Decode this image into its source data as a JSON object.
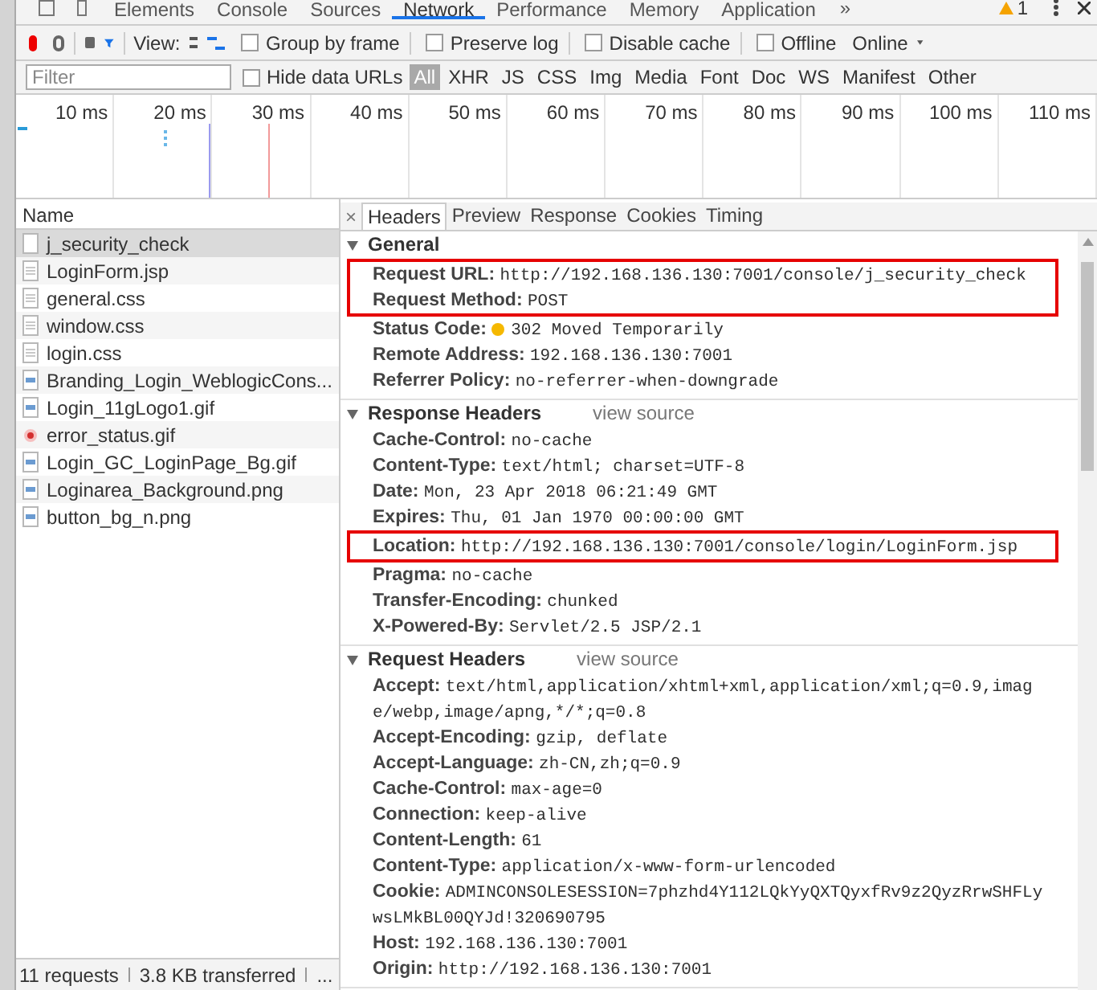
{
  "panel_tabs": [
    {
      "label": "Elements",
      "selected": false
    },
    {
      "label": "Console",
      "selected": false
    },
    {
      "label": "Sources",
      "selected": false
    },
    {
      "label": "Network",
      "selected": true
    },
    {
      "label": "Performance",
      "selected": false
    },
    {
      "label": "Memory",
      "selected": false
    },
    {
      "label": "Application",
      "selected": false
    }
  ],
  "more_tabs": "»",
  "warning_count": "1",
  "toolbar": {
    "recording": true,
    "view_label": "View:",
    "options": [
      {
        "label": "Group by frame",
        "checked": false
      },
      {
        "label": "Preserve log",
        "checked": false
      },
      {
        "label": "Disable cache",
        "checked": false
      },
      {
        "label": "Offline",
        "checked": false
      }
    ],
    "throttling": "Online"
  },
  "filter": {
    "placeholder": "Filter",
    "hide_data_urls": {
      "label": "Hide data URLs",
      "checked": false
    },
    "types": [
      {
        "label": "All",
        "selected": true
      },
      {
        "label": "XHR",
        "selected": false
      },
      {
        "label": "JS",
        "selected": false
      },
      {
        "label": "CSS",
        "selected": false
      },
      {
        "label": "Img",
        "selected": false
      },
      {
        "label": "Media",
        "selected": false
      },
      {
        "label": "Font",
        "selected": false
      },
      {
        "label": "Doc",
        "selected": false
      },
      {
        "label": "WS",
        "selected": false
      },
      {
        "label": "Manifest",
        "selected": false
      },
      {
        "label": "Other",
        "selected": false
      }
    ]
  },
  "timeline": {
    "ticks": [
      "10 ms",
      "20 ms",
      "30 ms",
      "40 ms",
      "50 ms",
      "60 ms",
      "70 ms",
      "80 ms",
      "90 ms",
      "100 ms",
      "110 ms"
    ]
  },
  "requests": {
    "column": "Name",
    "rows": [
      {
        "name": "j_security_check",
        "kind": "blank",
        "selected": true
      },
      {
        "name": "LoginForm.jsp",
        "kind": "document",
        "selected": false
      },
      {
        "name": "general.css",
        "kind": "document",
        "selected": false
      },
      {
        "name": "window.css",
        "kind": "document",
        "selected": false
      },
      {
        "name": "login.css",
        "kind": "document",
        "selected": false
      },
      {
        "name": "Branding_Login_WeblogicCons...",
        "kind": "image",
        "selected": false
      },
      {
        "name": "Login_11gLogo1.gif",
        "kind": "image",
        "selected": false
      },
      {
        "name": "error_status.gif",
        "kind": "error",
        "selected": false
      },
      {
        "name": "Login_GC_LoginPage_Bg.gif",
        "kind": "image",
        "selected": false
      },
      {
        "name": "Loginarea_Background.png",
        "kind": "image",
        "selected": false
      },
      {
        "name": "button_bg_n.png",
        "kind": "image",
        "selected": false
      }
    ]
  },
  "status_bar": [
    "11 requests",
    "3.8 KB transferred",
    "..."
  ],
  "close": "×",
  "detail_tabs": [
    {
      "label": "Headers",
      "selected": true
    },
    {
      "label": "Preview",
      "selected": false
    },
    {
      "label": "Response",
      "selected": false
    },
    {
      "label": "Cookies",
      "selected": false
    },
    {
      "label": "Timing",
      "selected": false
    }
  ],
  "sections": [
    {
      "title": "General",
      "headers": [
        {
          "name": "Request URL:",
          "value": "http://192.168.136.130:7001/console/j_security_check",
          "highlighted": true,
          "status_dot": false
        },
        {
          "name": "Request Method:",
          "value": "POST",
          "highlighted": true,
          "status_dot": false
        },
        {
          "name": "Status Code:",
          "value": "302 Moved Temporarily",
          "highlighted": false,
          "status_dot": true
        },
        {
          "name": "Remote Address:",
          "value": "192.168.136.130:7001",
          "highlighted": false,
          "status_dot": false
        },
        {
          "name": "Referrer Policy:",
          "value": "no-referrer-when-downgrade",
          "highlighted": false,
          "status_dot": false
        }
      ]
    },
    {
      "title": "Response Headers",
      "link": "view source",
      "headers": [
        {
          "name": "Cache-Control:",
          "value": "no-cache",
          "highlighted": false,
          "status_dot": false
        },
        {
          "name": "Content-Type:",
          "value": "text/html; charset=UTF-8",
          "highlighted": false,
          "status_dot": false
        },
        {
          "name": "Date:",
          "value": "Mon, 23 Apr 2018 06:21:49 GMT",
          "highlighted": false,
          "status_dot": false
        },
        {
          "name": "Expires:",
          "value": "Thu, 01 Jan 1970 00:00:00 GMT",
          "highlighted": false,
          "status_dot": false
        },
        {
          "name": "Location:",
          "value": "http://192.168.136.130:7001/console/login/LoginForm.jsp",
          "highlighted": true,
          "status_dot": false
        },
        {
          "name": "Pragma:",
          "value": "no-cache",
          "highlighted": false,
          "status_dot": false
        },
        {
          "name": "Transfer-Encoding:",
          "value": "chunked",
          "highlighted": false,
          "status_dot": false
        },
        {
          "name": "X-Powered-By:",
          "value": "Servlet/2.5 JSP/2.1",
          "highlighted": false,
          "status_dot": false
        }
      ]
    },
    {
      "title": "Request Headers",
      "link": "view source",
      "headers": [
        {
          "name": "Accept:",
          "value": "text/html,application/xhtml+xml,application/xml;q=0.9,image/webp,image/apng,*/*;q=0.8",
          "highlighted": false,
          "status_dot": false
        },
        {
          "name": "Accept-Encoding:",
          "value": "gzip, deflate",
          "highlighted": false,
          "status_dot": false
        },
        {
          "name": "Accept-Language:",
          "value": "zh-CN,zh;q=0.9",
          "highlighted": false,
          "status_dot": false
        },
        {
          "name": "Cache-Control:",
          "value": "max-age=0",
          "highlighted": false,
          "status_dot": false
        },
        {
          "name": "Connection:",
          "value": "keep-alive",
          "highlighted": false,
          "status_dot": false
        },
        {
          "name": "Content-Length:",
          "value": "61",
          "highlighted": false,
          "status_dot": false
        },
        {
          "name": "Content-Type:",
          "value": "application/x-www-form-urlencoded",
          "highlighted": false,
          "status_dot": false
        },
        {
          "name": "Cookie:",
          "value": "ADMINCONSOLESESSION=7phzhd4Y112LQkYyQXTQyxfRv9z2QyzRrwSHFLywsLMkBL00QYJd!320690795",
          "highlighted": false,
          "status_dot": false
        },
        {
          "name": "Host:",
          "value": "192.168.136.130:7001",
          "highlighted": false,
          "status_dot": false
        },
        {
          "name": "Origin:",
          "value": "http://192.168.136.130:7001",
          "highlighted": false,
          "status_dot": false
        }
      ]
    }
  ]
}
